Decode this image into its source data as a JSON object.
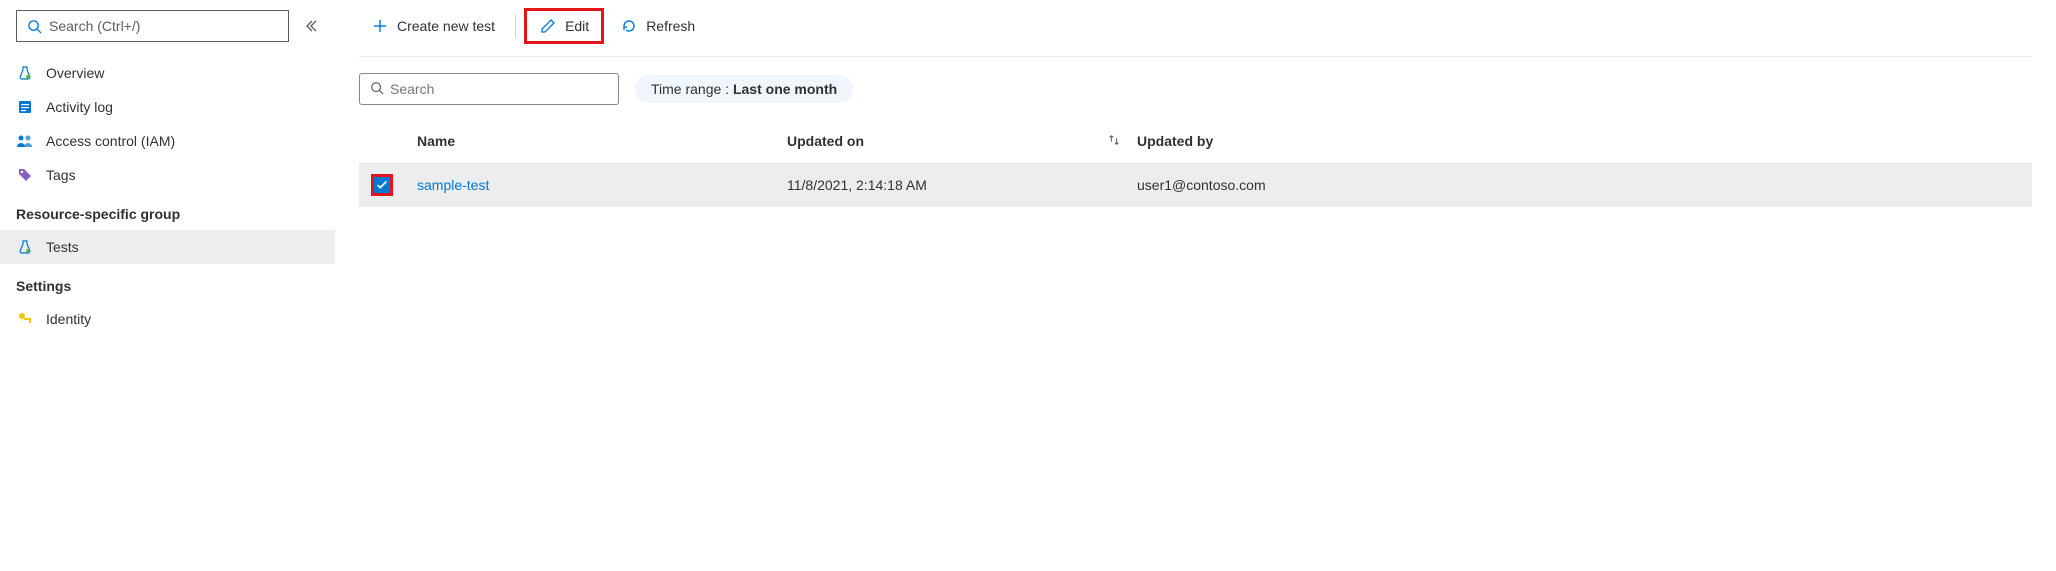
{
  "sidebar": {
    "search_placeholder": "Search (Ctrl+/)",
    "items": [
      {
        "label": "Overview"
      },
      {
        "label": "Activity log"
      },
      {
        "label": "Access control (IAM)"
      },
      {
        "label": "Tags"
      }
    ],
    "group1_header": "Resource-specific group",
    "group1_items": [
      {
        "label": "Tests"
      }
    ],
    "group2_header": "Settings",
    "group2_items": [
      {
        "label": "Identity"
      }
    ]
  },
  "toolbar": {
    "create_label": "Create new test",
    "edit_label": "Edit",
    "refresh_label": "Refresh"
  },
  "filters": {
    "search_placeholder": "Search",
    "time_range_prefix": "Time range : ",
    "time_range_value": "Last one month"
  },
  "table": {
    "columns": {
      "name": "Name",
      "updated_on": "Updated on",
      "updated_by": "Updated by"
    },
    "rows": [
      {
        "name": "sample-test",
        "updated_on": "11/8/2021, 2:14:18 AM",
        "updated_by": "user1@contoso.com",
        "checked": true
      }
    ]
  }
}
